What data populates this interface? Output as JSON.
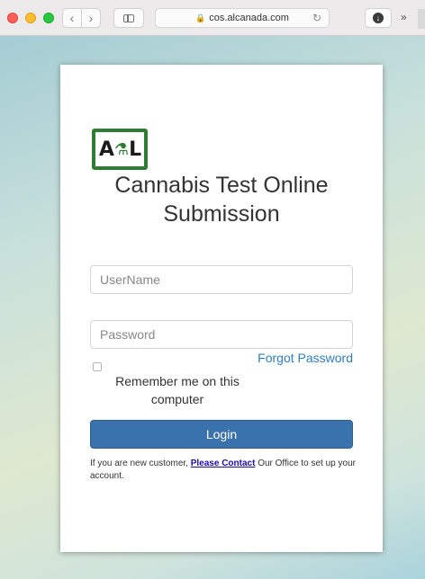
{
  "browser": {
    "url": "cos.alcanada.com",
    "lock_icon": "lock-icon",
    "back_glyph": "‹",
    "forward_glyph": "›",
    "reload_glyph": "↻",
    "download_glyph": "↓",
    "more_glyph": "»"
  },
  "logo": {
    "left": "A",
    "mid": "⚗",
    "right": "L"
  },
  "login": {
    "title": "Cannabis Test Online Submission",
    "username_placeholder": "UserName",
    "password_placeholder": "Password",
    "forgot_password": "Forgot Password",
    "remember_me": "Remember me on this computer",
    "login_button": "Login",
    "new_customer_prefix": "If you are new customer, ",
    "contact_link": "Please Contact",
    "new_customer_suffix": " Our Office to set up your account."
  },
  "colors": {
    "login_button": "#3a72ad",
    "link": "#2d7ec4",
    "logo_green": "#2f7d32"
  }
}
